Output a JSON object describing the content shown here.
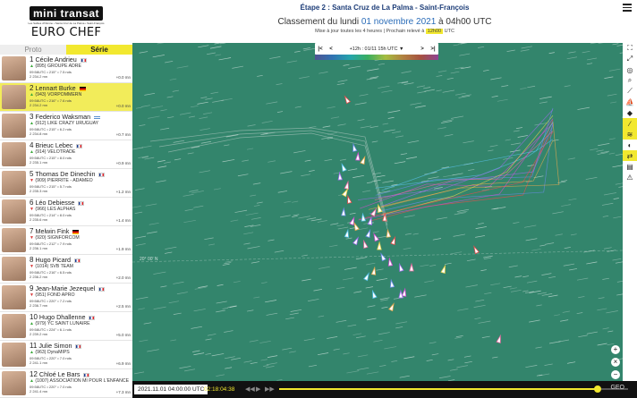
{
  "logo": {
    "name": "mini transat",
    "tagline": "Les Sables d'Olonne • Santa Cruz de La Palma • Saint-François",
    "sponsor": "EURO CHEF"
  },
  "tabs": {
    "proto": "Proto",
    "serie": "Série"
  },
  "header": {
    "stage": "Étape 2 : Santa Cruz de La Palma - Saint-François",
    "ranking_prefix": "Classement du lundi",
    "ranking_date": "01 novembre 2021",
    "ranking_suffix": "à 04h00 UTC",
    "update_text": "Mise à jour toutes les 4 heures | Prochain relevé à",
    "next_time": "12h00",
    "update_suffix": "UTC"
  },
  "skippers": [
    {
      "rank": "1",
      "name": "Cécile Andrieu",
      "flag": "fr",
      "trend": "up",
      "boat": "(895) GROUPE ADRE",
      "line1": "09:58UTC • 215° • 7.5 nds",
      "line2": "2 234.2 mn",
      "delta": "+0.0 mn"
    },
    {
      "rank": "2",
      "name": "Lennart Burke",
      "flag": "de",
      "trend": "up",
      "boat": "(943) VORPOMMERN",
      "line1": "09:58UTC • 216° • 7.6 nds",
      "line2": "2 234.2 mn",
      "delta": "+0.0 mn",
      "highlight": true
    },
    {
      "rank": "3",
      "name": "Federico Waksman",
      "flag": "uy",
      "trend": "up",
      "boat": "(912) LIKE CRAZY URUGUAY",
      "line1": "09:58UTC • 215° • 6.2 nds",
      "line2": "2 234.8 mn",
      "delta": "+0.7 mn"
    },
    {
      "rank": "4",
      "name": "Brieuc Lebec",
      "flag": "fr",
      "trend": "up",
      "boat": "(914) VELOTRADE",
      "line1": "09:58UTC • 215° • 8.0 nds",
      "line2": "2 235.1 mn",
      "delta": "+0.9 mn"
    },
    {
      "rank": "5",
      "name": "Thomas De Dinechin",
      "flag": "fr",
      "trend": "down",
      "boat": "(909) PIERRITE - ADAMEO",
      "line1": "09:58UTC • 215° • 5.7 nds",
      "line2": "2 235.3 mn",
      "delta": "+1.2 mn"
    },
    {
      "rank": "6",
      "name": "Léo Debiesse",
      "flag": "fr",
      "trend": "down",
      "boat": "(966) LES ALPHAS",
      "line1": "09:58UTC • 214° • 8.0 nds",
      "line2": "2 235.6 mn",
      "delta": "+1.4 mn"
    },
    {
      "rank": "7",
      "name": "Melwin Fink",
      "flag": "de",
      "trend": "down",
      "boat": "(920) SIGNFORCOM",
      "line1": "09:58UTC • 212° • 7.9 nds",
      "line2": "2 236.1 mn",
      "delta": "+1.9 mn"
    },
    {
      "rank": "8",
      "name": "Hugo Picard",
      "flag": "fr",
      "trend": "down",
      "boat": "(1014) SVB TEAM",
      "line1": "09:58UTC • 216° • 6.5 nds",
      "line2": "2 236.2 mn",
      "delta": "+2.0 mn"
    },
    {
      "rank": "9",
      "name": "Jean-Marie Jezequel",
      "flag": "fr",
      "trend": "down",
      "boat": "(951) FOND APRO",
      "line1": "09:58UTC • 220° • 7.2 nds",
      "line2": "2 236.7 mn",
      "delta": "+2.5 mn"
    },
    {
      "rank": "10",
      "name": "Hugo Dhallenne",
      "flag": "fr",
      "trend": "up",
      "boat": "(979) YC SAINT LUNAIRE",
      "line1": "09:58UTC • 224° • 6.1 nds",
      "line2": "2 239.2 mn",
      "delta": "+5.0 mn"
    },
    {
      "rank": "11",
      "name": "Julie Simon",
      "flag": "fr",
      "trend": "up",
      "boat": "(963) DynaMIPS",
      "line1": "09:58UTC • 220° • 7.0 nds",
      "line2": "2 241.1 mn",
      "delta": "+6.9 mn"
    },
    {
      "rank": "12",
      "name": "Chloé Le Bars",
      "flag": "fr",
      "trend": "up",
      "boat": "(1007) ASSOCIATION MI POUR L'ENFANCE",
      "line1": "09:58UTC • 220° • 7.0 nds",
      "line2": "2 241.4 mn",
      "delta": "+7.3 mn"
    }
  ],
  "time_ctrl": {
    "first": "|<",
    "prev": "<",
    "label": "+12h : 01/11 15h UTC ▼",
    "next": ">",
    "last": ">|"
  },
  "map": {
    "parallel_label": "20° 00' N",
    "bg_color": "#33856c"
  },
  "tools": [
    "fullscreen-icon",
    "expand-icon",
    "locate-icon",
    "zoom-search-icon",
    "route-icon",
    "boats-icon",
    "tag-icon",
    "trace-icon",
    "wind-icon",
    "ocean-icon",
    "ruler-icon",
    "table-icon",
    "warning-icon"
  ],
  "zoom": {
    "in": "+",
    "reset": "×",
    "out": "−"
  },
  "bottombar": {
    "datetime": "2021.11.01 04:00:00 UTC",
    "elapsed": "02:18:04:38",
    "logo": "GEO"
  },
  "colors": {
    "accent": "#f2e82f",
    "title_blue": "#1d3d78",
    "sea": "#33856c"
  }
}
